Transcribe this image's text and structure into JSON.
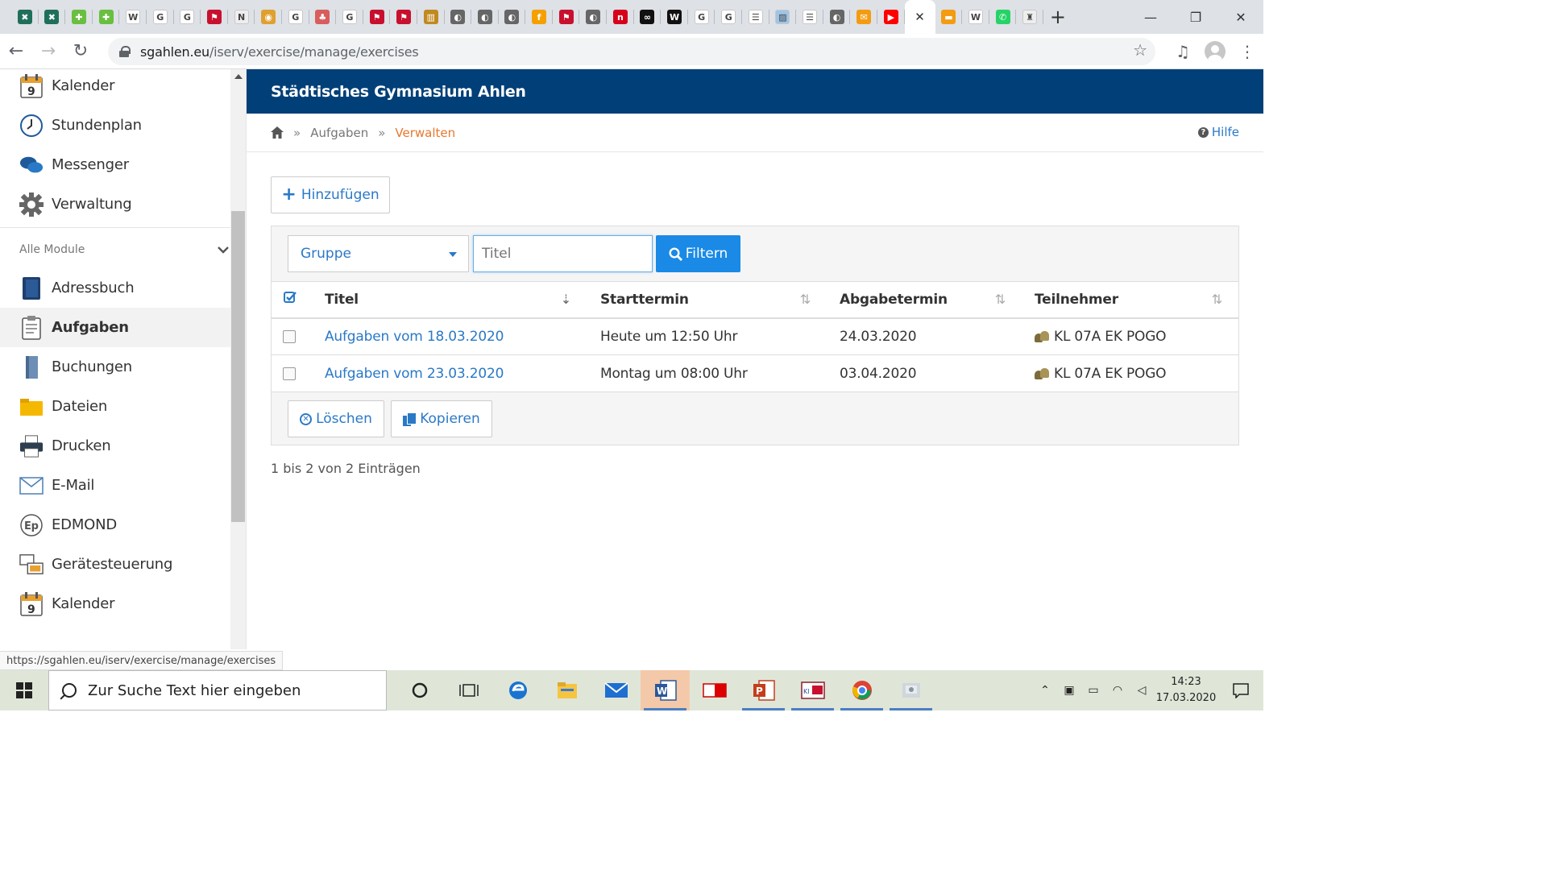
{
  "browser": {
    "tabs": [
      {
        "icon": "iserv-icon",
        "color": "#1f6f5c",
        "glyph": "✖"
      },
      {
        "icon": "iserv-icon",
        "color": "#1f6f5c",
        "glyph": "✖"
      },
      {
        "icon": "green-app-icon",
        "color": "#6abf40",
        "glyph": "✚"
      },
      {
        "icon": "green-app-icon",
        "color": "#6abf40",
        "glyph": "✚"
      },
      {
        "icon": "wikipedia-icon",
        "color": "#ffffff",
        "glyph": "W"
      },
      {
        "icon": "google-icon",
        "color": "#ffffff",
        "glyph": "G"
      },
      {
        "icon": "google-icon",
        "color": "#ffffff",
        "glyph": "G"
      },
      {
        "icon": "nrw-icon",
        "color": "#c8102e",
        "glyph": "⚑"
      },
      {
        "icon": "news-icon",
        "color": "#eeeeee",
        "glyph": "N"
      },
      {
        "icon": "colorful-app-icon",
        "color": "#e0a030",
        "glyph": "◉"
      },
      {
        "icon": "google-icon",
        "color": "#ffffff",
        "glyph": "G"
      },
      {
        "icon": "school-icon",
        "color": "#d85d5d",
        "glyph": "♣"
      },
      {
        "icon": "google-icon",
        "color": "#ffffff",
        "glyph": "G"
      },
      {
        "icon": "nrw-icon",
        "color": "#c8102e",
        "glyph": "⚑"
      },
      {
        "icon": "nrw-icon",
        "color": "#c8102e",
        "glyph": "⚑"
      },
      {
        "icon": "books-icon",
        "color": "#c08a20",
        "glyph": "▥"
      },
      {
        "icon": "globe-icon",
        "color": "#666666",
        "glyph": "◐"
      },
      {
        "icon": "globe-icon",
        "color": "#666666",
        "glyph": "◐"
      },
      {
        "icon": "globe-icon",
        "color": "#666666",
        "glyph": "◐"
      },
      {
        "icon": "fn-icon",
        "color": "#f5a000",
        "glyph": "f"
      },
      {
        "icon": "nrw-icon",
        "color": "#c8102e",
        "glyph": "⚑"
      },
      {
        "icon": "globe-icon",
        "color": "#666666",
        "glyph": "◐"
      },
      {
        "icon": "ntv-icon",
        "color": "#d6001c",
        "glyph": "n"
      },
      {
        "icon": "tv-icon",
        "color": "#111111",
        "glyph": "∞"
      },
      {
        "icon": "w-icon",
        "color": "#111111",
        "glyph": "W"
      },
      {
        "icon": "google-icon",
        "color": "#ffffff",
        "glyph": "G"
      },
      {
        "icon": "google-icon",
        "color": "#ffffff",
        "glyph": "G"
      },
      {
        "icon": "list-icon",
        "color": "#ffffff",
        "glyph": "☰"
      },
      {
        "icon": "image-icon",
        "color": "#9ec5e8",
        "glyph": "▨"
      },
      {
        "icon": "list-icon",
        "color": "#ffffff",
        "glyph": "☰"
      },
      {
        "icon": "globe-icon",
        "color": "#666666",
        "glyph": "◐"
      },
      {
        "icon": "mail-icon",
        "color": "#f39c12",
        "glyph": "✉"
      },
      {
        "icon": "youtube-icon",
        "color": "#ff0000",
        "glyph": "▶"
      },
      {
        "icon": "close-icon",
        "color": "#ffffff",
        "glyph": "✕",
        "active": true
      },
      {
        "icon": "flag-icon",
        "color": "#f39c12",
        "glyph": "▬"
      },
      {
        "icon": "wikipedia-icon",
        "color": "#ffffff",
        "glyph": "W"
      },
      {
        "icon": "whatsapp-icon",
        "color": "#25d366",
        "glyph": "✆"
      },
      {
        "icon": "crest-icon",
        "color": "#eeeeee",
        "glyph": "♜"
      }
    ],
    "url_host": "sgahlen.eu",
    "url_path": "/iserv/exercise/manage/exercises",
    "status_url": "https://sgahlen.eu/iserv/exercise/manage/exercises"
  },
  "sidebar": {
    "top_items": [
      {
        "name": "kalender",
        "label": "Kalender",
        "icon": "calendar-icon"
      },
      {
        "name": "stundenplan",
        "label": "Stundenplan",
        "icon": "clock-icon"
      },
      {
        "name": "messenger",
        "label": "Messenger",
        "icon": "chat-icon"
      },
      {
        "name": "verwaltung",
        "label": "Verwaltung",
        "icon": "gear-icon"
      }
    ],
    "section_label": "Alle Module",
    "module_items": [
      {
        "name": "adressbuch",
        "label": "Adressbuch",
        "icon": "addressbook-icon"
      },
      {
        "name": "aufgaben",
        "label": "Aufgaben",
        "icon": "clipboard-icon",
        "active": true
      },
      {
        "name": "buchungen",
        "label": "Buchungen",
        "icon": "book-icon"
      },
      {
        "name": "dateien",
        "label": "Dateien",
        "icon": "folder-icon"
      },
      {
        "name": "drucken",
        "label": "Drucken",
        "icon": "printer-icon"
      },
      {
        "name": "email",
        "label": "E-Mail",
        "icon": "envelope-icon"
      },
      {
        "name": "edmond",
        "label": "EDMOND",
        "icon": "edmond-icon"
      },
      {
        "name": "geraetesteuerung",
        "label": "Gerätesteuerung",
        "icon": "device-icon"
      },
      {
        "name": "kalender2",
        "label": "Kalender",
        "icon": "calendar-icon"
      }
    ]
  },
  "header": {
    "title": "Städtisches Gymnasium Ahlen"
  },
  "breadcrumb": {
    "level1": "Aufgaben",
    "level2": "Verwalten",
    "separator": "»",
    "help": "Hilfe"
  },
  "actions": {
    "add": "Hinzufügen",
    "delete": "Löschen",
    "copy": "Kopieren"
  },
  "filter": {
    "group_label": "Gruppe",
    "title_placeholder": "Titel",
    "button": "Filtern"
  },
  "table": {
    "columns": [
      "Titel",
      "Starttermin",
      "Abgabetermin",
      "Teilnehmer"
    ],
    "rows": [
      {
        "title": "Aufgaben vom 18.03.2020",
        "start": "Heute um 12:50 Uhr",
        "due": "24.03.2020",
        "participants": "KL 07A EK POGO"
      },
      {
        "title": "Aufgaben vom 23.03.2020",
        "start": "Montag um 08:00 Uhr",
        "due": "03.04.2020",
        "participants": "KL 07A EK POGO"
      }
    ],
    "summary": "1 bis 2 von 2 Einträgen"
  },
  "taskbar": {
    "search_placeholder": "Zur Suche Text hier eingeben",
    "time": "14:23",
    "date": "17.03.2020"
  },
  "colors": {
    "header_bg": "#003f77",
    "link": "#2a79c7",
    "accent": "#e8772e",
    "primary_button": "#1a8ae6"
  }
}
